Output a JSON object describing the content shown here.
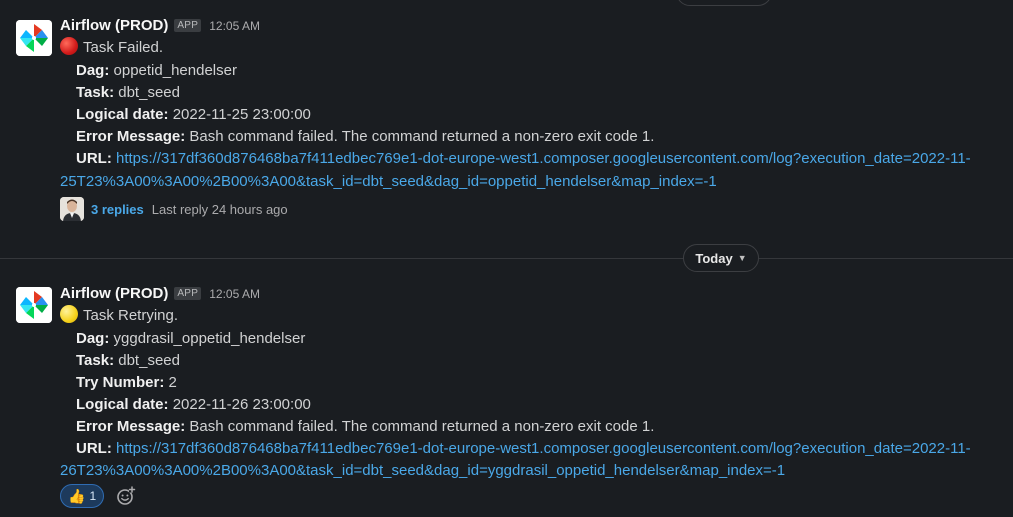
{
  "messages": [
    {
      "sender": "Airflow (PROD)",
      "badge": "APP",
      "time": "12:05 AM",
      "status_text": "Task Failed.",
      "status_color": "#d21a1a",
      "fields": [
        {
          "label": "Dag",
          "value": "oppetid_hendelser"
        },
        {
          "label": "Task",
          "value": "dbt_seed"
        },
        {
          "label": "Logical date",
          "value": "2022-11-25 23:00:00"
        },
        {
          "label": "Error Message",
          "value": "Bash command failed. The command returned a non-zero exit code 1."
        }
      ],
      "url_label": "URL",
      "url_line1": "https://317df360d876468ba7f411edbec769e1-dot-europe-west1.composer.googleusercontent.com/log?execution_date=2022-11-",
      "url_line2": "25T23%3A00%3A00%2B00%3A00&task_id=dbt_seed&dag_id=oppetid_hendelser&map_index=-1",
      "thread": {
        "replies": "3 replies",
        "last_reply": "Last reply 24 hours ago"
      }
    },
    {
      "sender": "Airflow (PROD)",
      "badge": "APP",
      "time": "12:05 AM",
      "status_text": "Task Retrying.",
      "status_color": "#f6d21b",
      "fields": [
        {
          "label": "Dag",
          "value": "yggdrasil_oppetid_hendelser"
        },
        {
          "label": "Task",
          "value": "dbt_seed"
        },
        {
          "label": "Try Number",
          "value": "2"
        },
        {
          "label": "Logical date",
          "value": "2022-11-26 23:00:00"
        },
        {
          "label": "Error Message",
          "value": "Bash command failed. The command returned a non-zero exit code 1."
        }
      ],
      "url_label": "URL",
      "url_line1": "https://317df360d876468ba7f411edbec769e1-dot-europe-west1.composer.googleusercontent.com/log?execution_date=2022-11-",
      "url_line2": "26T23%3A00%3A00%2B00%3A00&task_id=dbt_seed&dag_id=yggdrasil_oppetid_hendelser&map_index=-1",
      "reactions": [
        {
          "emoji": "👍",
          "count": "1"
        }
      ]
    }
  ],
  "date_divider": {
    "label": "Today"
  },
  "icons": {
    "app_avatar": "airflow-pinwheel-icon",
    "status_failed": "red-circle-icon",
    "status_retry": "yellow-circle-icon",
    "divider_chevron": "chevron-down-icon",
    "add_reaction": "add-emoji-icon"
  }
}
